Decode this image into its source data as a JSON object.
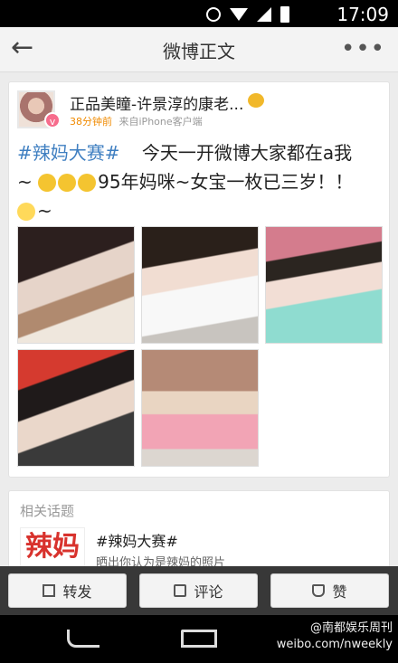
{
  "status_bar": {
    "time": "17:09",
    "icons": [
      "alarm-icon",
      "wifi-icon",
      "signal-icon",
      "battery-icon"
    ]
  },
  "title_bar": {
    "title": "微博正文",
    "back_icon": "←",
    "more_icon": "•••"
  },
  "post": {
    "username": "正品美瞳-许景淳的康老...",
    "vip_badge": "v",
    "time": "38分钟前",
    "source": "来自iPhone客户端",
    "hashtag": "#辣妈大赛#",
    "text_1": "今天一开微博大家都在a我~",
    "text_2": "95年妈咪~女宝一枚已三岁！！",
    "text_3": "~",
    "photos": [
      "photo-1",
      "photo-2",
      "photo-3",
      "photo-4",
      "photo-5"
    ]
  },
  "related": {
    "header": "相关话题",
    "thumb_text": "辣妈",
    "title": "#辣妈大赛#",
    "desc": "晒出你认为是辣妈的照片"
  },
  "actions": {
    "repost": "转发",
    "comment": "评论",
    "like": "赞"
  },
  "watermark": {
    "line1": "@南都娱乐周刊",
    "line2": "weibo.com/nweekly"
  }
}
